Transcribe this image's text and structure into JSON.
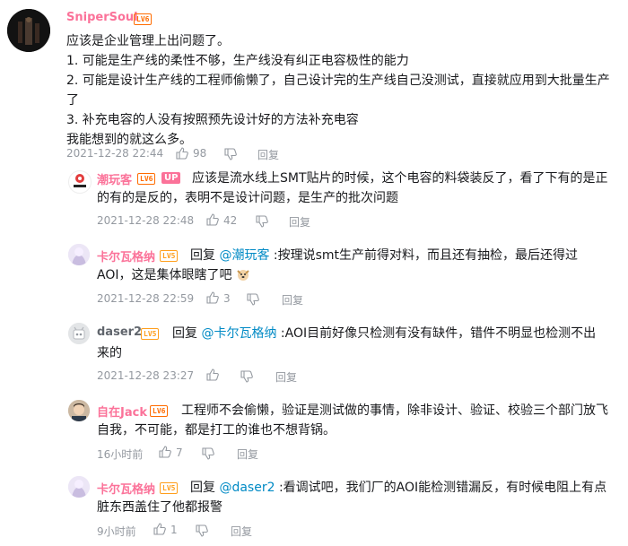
{
  "colors": {
    "username_pink": "#fb7299",
    "username_gray": "#61666d",
    "level_lv6": "#ff6c00",
    "level_lv5": "#ff9e1b",
    "mention": "#008ac5",
    "meta": "#9499a0"
  },
  "main_comment": {
    "username": "SniperSoul",
    "level": "LV6",
    "lines": [
      "应该是企业管理上出问题了。",
      "1. 可能是生产线的柔性不够，生产线没有纠正电容极性的能力",
      "2. 可能是设计生产线的工程师偷懒了，自己设计完的生产线自己没测试，直接就应用到大批量生产了",
      "3. 补充电容的人没有按照预先设计好的方法补充电容",
      "我能想到的就这么多。"
    ],
    "time": "2021-12-28 22:44",
    "likes": "98",
    "reply": "回复"
  },
  "replies": [
    {
      "username": "潮玩客",
      "level": "LV6",
      "badge": "UP",
      "prefix": "",
      "mention": "",
      "text": "应该是流水线上SMT贴片的时候，这个电容的料袋装反了，看了下有的是正的有的是反的，表明不是设计问题，是生产的批次问题",
      "time": "2021-12-28 22:48",
      "likes": "42",
      "reply": "回复"
    },
    {
      "username": "卡尔瓦格纳",
      "level": "LV5",
      "prefix": "回复",
      "mention": "@潮玩客",
      "text": ":按理说smt生产前得对料，而且还有抽检，最后还得过AOI，这是集体眼瞎了吧",
      "time": "2021-12-28 22:59",
      "likes": "3",
      "reply": "回复"
    },
    {
      "username": "daser2",
      "level": "LV5",
      "prefix": "回复",
      "mention": "@卡尔瓦格纳",
      "text": ":AOI目前好像只检测有没有缺件，错件不明显也检测不出来的",
      "time": "2021-12-28 23:27",
      "likes": "",
      "reply": "回复"
    },
    {
      "username": "自在Jack",
      "level": "LV6",
      "prefix": "",
      "mention": "",
      "text": "工程师不会偷懒，验证是测试做的事情，除非设计、验证、校验三个部门放飞自我，不可能，都是打工的谁也不想背锅。",
      "time": "16小时前",
      "likes": "7",
      "reply": "回复"
    },
    {
      "username": "卡尔瓦格纳",
      "level": "LV5",
      "prefix": "回复",
      "mention": "@daser2",
      "text": ":看调试吧，我们厂的AOI能检测错漏反，有时候电阻上有点脏东西盖住了他都报警",
      "time": "9小时前",
      "likes": "1",
      "reply": "回复"
    }
  ]
}
